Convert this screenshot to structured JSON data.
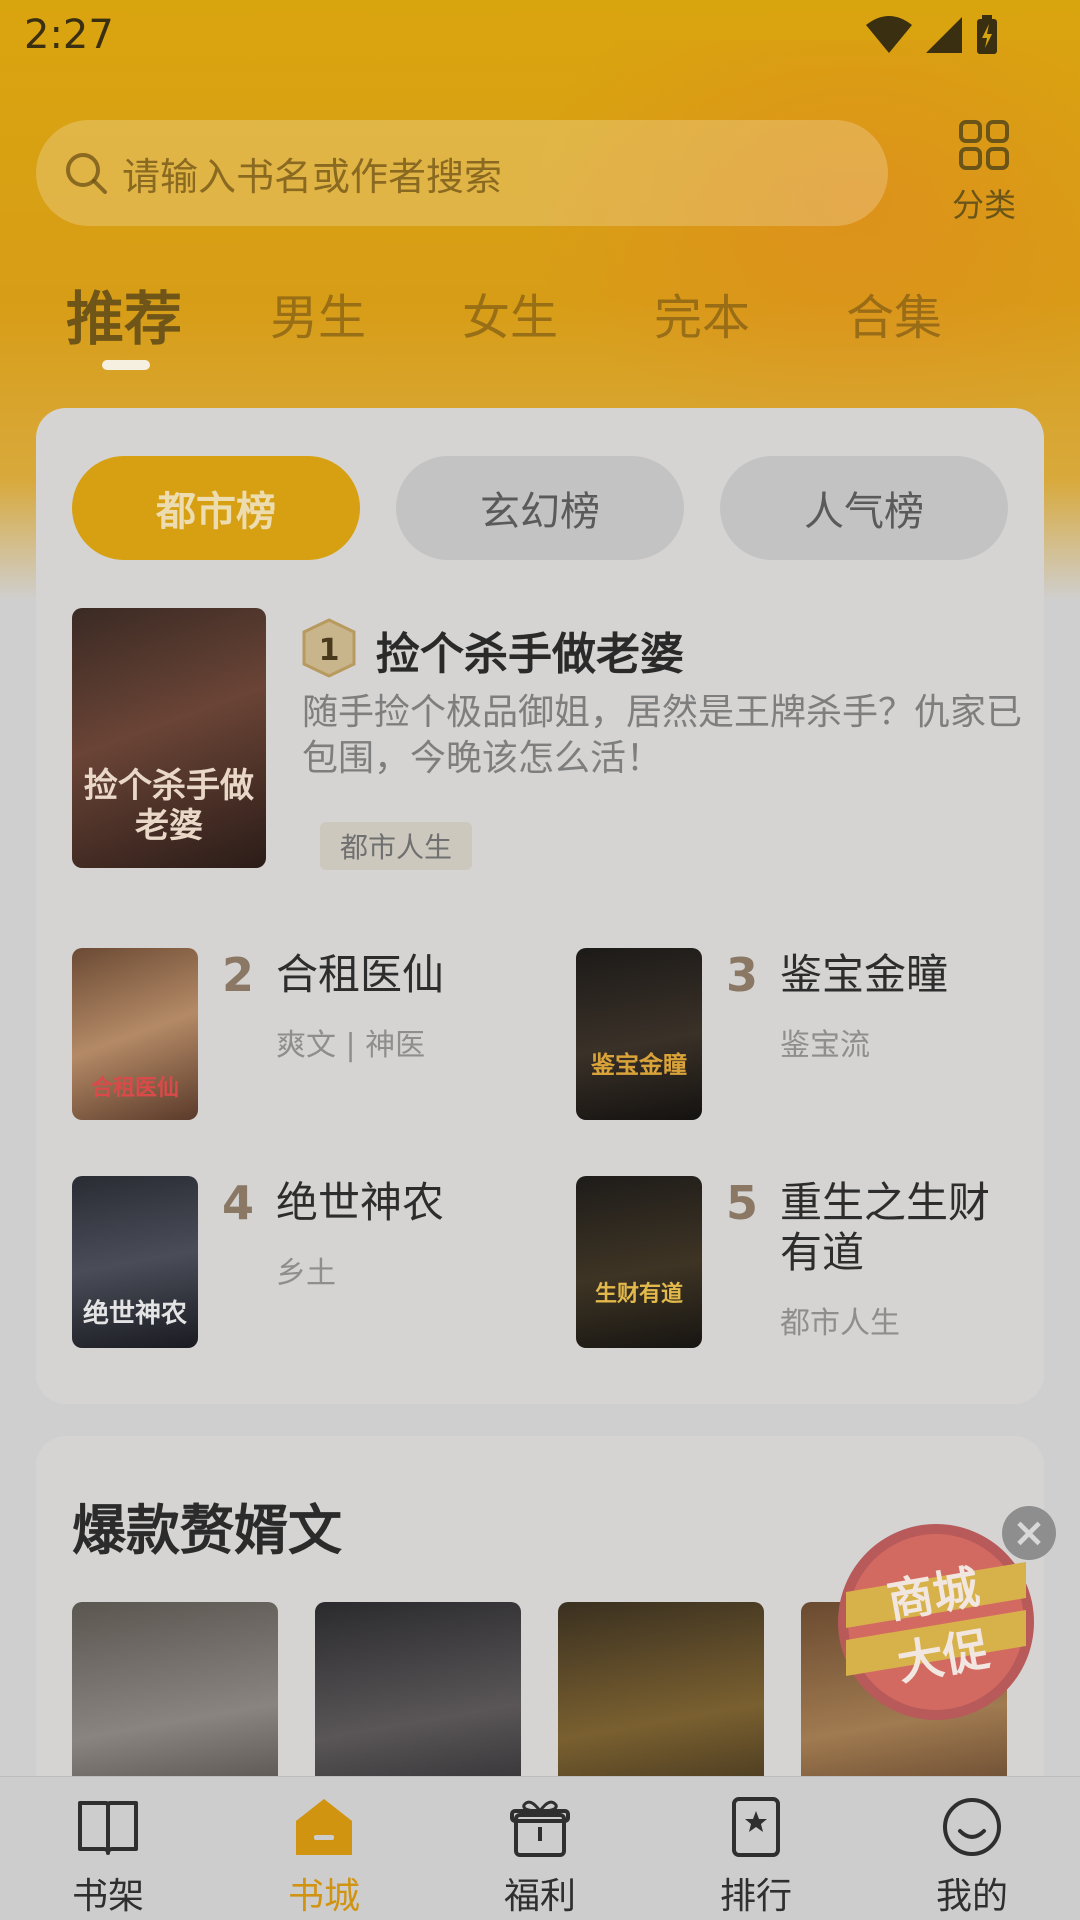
{
  "status_bar": {
    "time": "2:27"
  },
  "search": {
    "placeholder": "请输入书名或作者搜索"
  },
  "category_button": {
    "label": "分类"
  },
  "top_tabs": [
    "推荐",
    "男生",
    "女生",
    "完本",
    "合集"
  ],
  "ranking": {
    "tabs": [
      "都市榜",
      "玄幻榜",
      "人气榜"
    ],
    "books": [
      {
        "rank": "1",
        "title": "捡个杀手做老婆",
        "desc": "随手捡个极品御姐，居然是王牌杀手？仇家已包围，今晚该怎么活！",
        "tag": "都市人生",
        "cover_text": "捡个杀手做老婆"
      },
      {
        "rank": "2",
        "title": "合租医仙",
        "sub": "爽文 | 神医",
        "cover_text": "合租医仙"
      },
      {
        "rank": "3",
        "title": "鉴宝金瞳",
        "sub": "鉴宝流",
        "cover_text": "鉴宝金瞳"
      },
      {
        "rank": "4",
        "title": "绝世神农",
        "sub": "乡土",
        "cover_text": "绝世神农"
      },
      {
        "rank": "5",
        "title": "重生之生财有道",
        "sub": "都市人生",
        "cover_text": "生财有道"
      }
    ]
  },
  "hot_section": {
    "title": "爆款赘婿文"
  },
  "promo": {
    "line1": "商城",
    "line2": "大促"
  },
  "bottom_nav": [
    {
      "label": "书架",
      "icon": "book-open-icon"
    },
    {
      "label": "书城",
      "icon": "store-icon"
    },
    {
      "label": "福利",
      "icon": "gift-icon"
    },
    {
      "label": "排行",
      "icon": "ranking-icon"
    },
    {
      "label": "我的",
      "icon": "profile-icon"
    }
  ],
  "colors": {
    "accent": "#d6a012",
    "active_nav": "#d19411"
  }
}
